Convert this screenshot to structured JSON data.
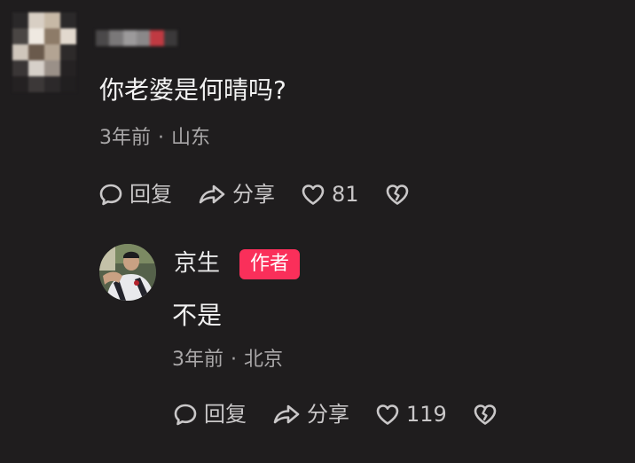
{
  "colors": {
    "background": "#1f1d1e",
    "primary_text": "#f2f2f2",
    "secondary_text": "#a9a7a8",
    "action_text": "#c9c7c8",
    "author_badge": "#fa2f5a"
  },
  "comment": {
    "user": {
      "avatar": "pixelated-avatar",
      "name_obscured": true
    },
    "text": "你老婆是何晴吗?",
    "time": "3年前",
    "location": "山东",
    "separator": "·",
    "actions": {
      "reply_label": "回复",
      "share_label": "分享",
      "like_count": "81"
    }
  },
  "reply": {
    "user": {
      "name": "京生",
      "badge": "作者"
    },
    "text": "不是",
    "time": "3年前",
    "location": "北京",
    "separator": "·",
    "actions": {
      "reply_label": "回复",
      "share_label": "分享",
      "like_count": "119"
    }
  }
}
